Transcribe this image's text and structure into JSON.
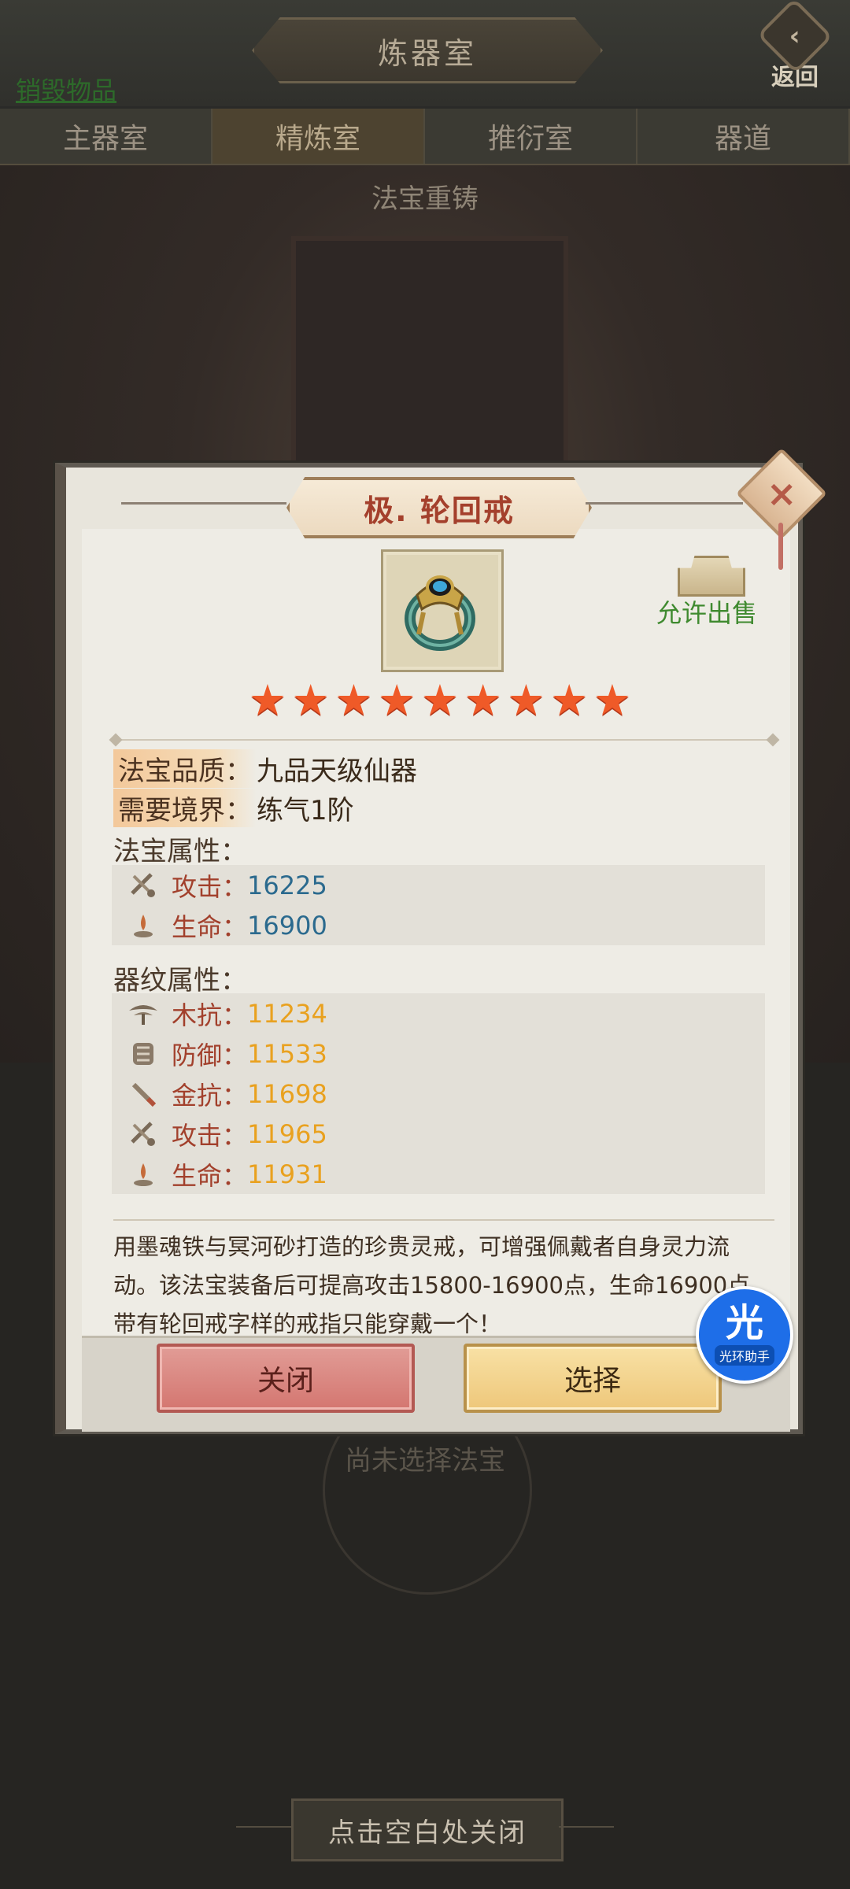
{
  "header": {
    "title": "炼器室",
    "back_label": "返回",
    "back_icon": "back-arrow-icon",
    "destroy_link": "销毁物品"
  },
  "tabs": [
    {
      "label": "主器室",
      "active": false
    },
    {
      "label": "精炼室",
      "active": true
    },
    {
      "label": "推衍室",
      "active": false
    },
    {
      "label": "器道",
      "active": false
    }
  ],
  "scene": {
    "title": "法宝重铸",
    "not_selected": "尚未选择法宝",
    "close_hint": "点击空白处关闭"
  },
  "modal": {
    "title": "极. 轮回戒",
    "sale_label": "允许出售",
    "star_count": 9,
    "quality_key": "法宝品质：",
    "quality_val": "九品天级仙器",
    "realm_key": "需要境界：",
    "realm_val": "练气1阶",
    "base_attr_label": "法宝属性：",
    "base_attrs": [
      {
        "icon": "attack-icon",
        "name": "攻击：",
        "value": "16225"
      },
      {
        "icon": "life-icon",
        "name": "生命：",
        "value": "16900"
      }
    ],
    "rune_attr_label": "器纹属性：",
    "rune_attrs": [
      {
        "icon": "wood-resist-icon",
        "name": "木抗：",
        "value": "11234"
      },
      {
        "icon": "defense-icon",
        "name": "防御：",
        "value": "11533"
      },
      {
        "icon": "metal-resist-icon",
        "name": "金抗：",
        "value": "11698"
      },
      {
        "icon": "attack-icon",
        "name": "攻击：",
        "value": "11965"
      },
      {
        "icon": "life-icon",
        "name": "生命：",
        "value": "11931"
      }
    ],
    "description": "用墨魂铁与冥河砂打造的珍贵灵戒，可增强佩戴者自身灵力流动。该法宝装备后可提高攻击15800-16900点，生命16900点。带有轮回戒字样的戒指只能穿戴一个！",
    "close_button": "关闭",
    "select_button": "选择"
  },
  "helper": {
    "main": "光",
    "sub": "光环助手"
  },
  "colors": {
    "title_red": "#a4402c",
    "attr_blue": "#2b6a8e",
    "attr_gold": "#e9a11f",
    "star_orange": "#ef5a28",
    "sale_green": "#3f8a2f"
  }
}
